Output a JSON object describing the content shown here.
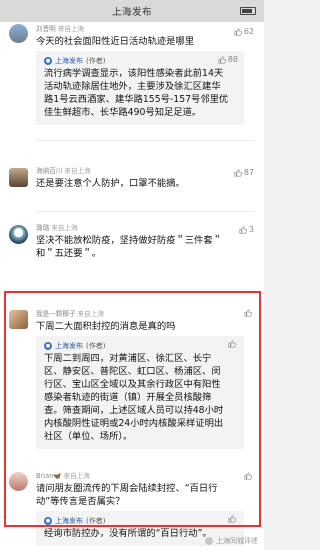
{
  "app": {
    "title": "上海发布"
  },
  "comments": [
    {
      "user": "刘晋明",
      "location": "来自上海",
      "text": [
        "今天的社会面阳性近日活动轨迹是哪里"
      ],
      "likes": "62",
      "reply": {
        "name": "上海发布",
        "author": "(作者)",
        "likes": "88",
        "lines": [
          "流行病学调查显示，该阳性感染者此前14天",
          "活动轨迹除居住地外，主要涉及徐汇区建华",
          "路1号云西酒家、建华路155号-157号邻里优",
          "佳生鲜超市、长华路490号知足足道。"
        ]
      }
    },
    {
      "user": "海纳百川",
      "location": "来自上海",
      "text": [
        "还是要注意个人防护，口罩不能摘。"
      ],
      "likes": "87"
    },
    {
      "user": "璐璐",
      "location": "来自上海",
      "text": [
        "坚决不能放松防疫，坚持做好防疫＂三件套＂",
        "和＂五还要＂。"
      ],
      "likes": "3"
    },
    {
      "user": "我是一颗椰子",
      "location": "来自上海",
      "text": [
        "下周二大面积封控的消息是真的吗"
      ],
      "likes": "",
      "reply": {
        "name": "上海发布",
        "author": "(作者)",
        "likes": "",
        "lines": [
          "下周二到周四，对黄浦区、徐汇区、长宁",
          "区、静安区、普陀区、虹口区、杨浦区、闵",
          "行区、宝山区全域以及其余行政区中有阳性",
          "感染者轨迹的街道（镇）开展全员核酸筛",
          "查。筛查期间，上述区域人员可以持48小时",
          "内核酸阴性证明或24小时内核酸采样证明出",
          "社区（单位、场所）。"
        ]
      }
    },
    {
      "user": "Brian🦋",
      "location": "来自上海",
      "text": [
        "请问朋友圈流传的下周会陆续封控、“百日行",
        "动”等传言是否属实？"
      ],
      "likes": "",
      "reply": {
        "name": "上海发布",
        "author": "(作者)",
        "likes": "",
        "lines": [
          "经询市防控办，没有所谓的“百日行动”。"
        ]
      }
    }
  ],
  "watermark": "上海同城评述",
  "colors": {
    "highlight": "#e63333",
    "accent": "#3b73c8"
  }
}
